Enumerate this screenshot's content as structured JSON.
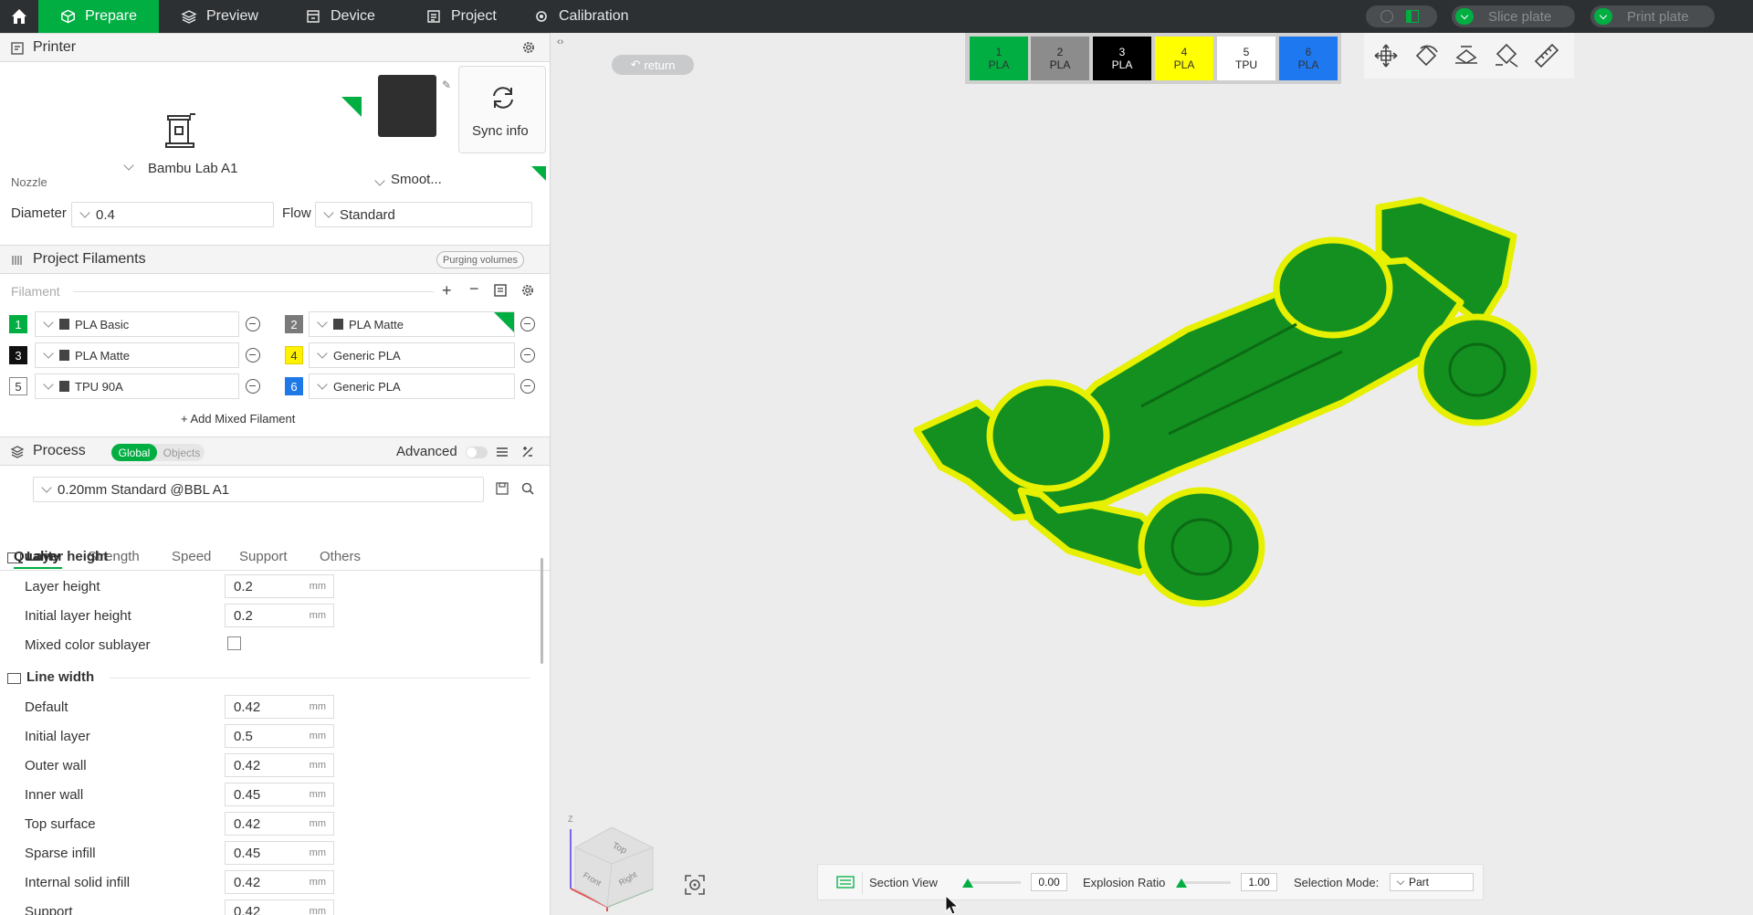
{
  "topbar": {
    "tabs": [
      {
        "label": "Prepare",
        "icon": "cube-icon"
      },
      {
        "label": "Preview",
        "icon": "layers-icon"
      },
      {
        "label": "Device",
        "icon": "device-icon"
      },
      {
        "label": "Project",
        "icon": "project-icon"
      },
      {
        "label": "Calibration",
        "icon": "calibration-icon"
      }
    ],
    "slice_label": "Slice plate",
    "print_label": "Print plate"
  },
  "printer": {
    "title": "Printer",
    "name": "Bambu Lab A1",
    "plate": "Smoot...",
    "sync_label": "Sync info",
    "nozzle_label": "Nozzle",
    "diameter_label": "Diameter",
    "diameter_value": "0.4",
    "flow_label": "Flow",
    "flow_value": "Standard"
  },
  "filaments": {
    "title": "Project Filaments",
    "purge_label": "Purging volumes",
    "filament_label": "Filament",
    "items": [
      {
        "num": "1",
        "name": "PLA Basic",
        "color": "#00ae42",
        "text_color": "#ffffff",
        "branded": true
      },
      {
        "num": "2",
        "name": "PLA Matte",
        "color": "#7a7a7a",
        "text_color": "#ffffff",
        "branded": true
      },
      {
        "num": "3",
        "name": "PLA Matte",
        "color": "#111111",
        "text_color": "#ffffff",
        "branded": true
      },
      {
        "num": "4",
        "name": "Generic PLA",
        "color": "#fff200",
        "text_color": "#333333",
        "branded": false
      },
      {
        "num": "5",
        "name": "TPU 90A",
        "color": "#ffffff",
        "text_color": "#333333",
        "branded": true
      },
      {
        "num": "6",
        "name": "Generic PLA",
        "color": "#1e78e6",
        "text_color": "#ffffff",
        "branded": false
      }
    ],
    "add_mixed_label": "+ Add Mixed Filament"
  },
  "process": {
    "title": "Process",
    "global_label": "Global",
    "objects_label": "Objects",
    "advanced_label": "Advanced",
    "preset": "0.20mm Standard @BBL A1",
    "tabs": [
      "Quality",
      "Strength",
      "Speed",
      "Support",
      "Others"
    ],
    "layer_height_group": "Layer height",
    "line_width_group": "Line width",
    "unit": "mm",
    "layer_params": [
      {
        "label": "Layer height",
        "value": "0.2"
      },
      {
        "label": "Initial layer height",
        "value": "0.2"
      }
    ],
    "mixed_sublayer_label": "Mixed color sublayer",
    "line_params": [
      {
        "label": "Default",
        "value": "0.42"
      },
      {
        "label": "Initial layer",
        "value": "0.5"
      },
      {
        "label": "Outer wall",
        "value": "0.42"
      },
      {
        "label": "Inner wall",
        "value": "0.45"
      },
      {
        "label": "Top surface",
        "value": "0.42"
      },
      {
        "label": "Sparse infill",
        "value": "0.45"
      },
      {
        "label": "Internal solid infill",
        "value": "0.42"
      },
      {
        "label": "Support",
        "value": "0.42"
      }
    ]
  },
  "viewport": {
    "return_label": "return",
    "slots": [
      {
        "num": "1",
        "type": "PLA",
        "color": "#00ae42",
        "text_color": "#333333"
      },
      {
        "num": "2",
        "type": "PLA",
        "color": "#8c8c8c",
        "text_color": "#222222"
      },
      {
        "num": "3",
        "type": "PLA",
        "color": "#000000",
        "text_color": "#ffffff"
      },
      {
        "num": "4",
        "type": "PLA",
        "color": "#ffff00",
        "text_color": "#333333"
      },
      {
        "num": "5",
        "type": "TPU",
        "color": "#ffffff",
        "text_color": "#222222"
      },
      {
        "num": "6",
        "type": "PLA",
        "color": "#1e78f0",
        "text_color": "#333333"
      }
    ],
    "section_view_label": "Section View",
    "section_value": "0.00",
    "explosion_label": "Explosion Ratio",
    "explosion_value": "1.00",
    "selection_mode_label": "Selection Mode:",
    "selection_mode_value": "Part",
    "cube_labels": {
      "top": "Top",
      "front": "Front",
      "right": "Right",
      "z": "Z"
    }
  },
  "colors": {
    "accent": "#00ae42",
    "model": "#13901f",
    "outline": "#e6f000"
  }
}
